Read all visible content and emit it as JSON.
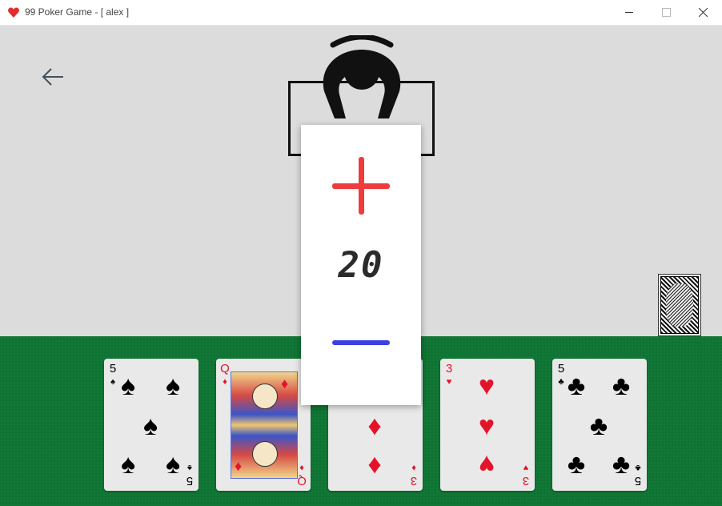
{
  "window": {
    "title": "99 Poker Game - [ alex ]",
    "icon": "heart-icon",
    "controls": [
      "minimize-icon",
      "maximize-icon",
      "close-icon"
    ]
  },
  "colors": {
    "table": "#dcdcdc",
    "felt": "#0e7433",
    "plus": "#ee3b3b",
    "minus": "#3b3fe6",
    "red_suit": "#e4132a"
  },
  "back_button": {
    "icon": "arrow-left-icon"
  },
  "opponent": {
    "icon": "player-seat-icon"
  },
  "deck": {
    "icon": "card-back-icon"
  },
  "value_popup": {
    "value": "20",
    "increase_icon": "plus-icon",
    "decrease_icon": "minus-icon"
  },
  "hand": [
    {
      "rank": "5",
      "suit": "♠",
      "color": "black"
    },
    {
      "rank": "Q",
      "suit": "♦",
      "color": "red"
    },
    {
      "rank": "3",
      "suit": "♦",
      "color": "red"
    },
    {
      "rank": "3",
      "suit": "♥",
      "color": "red"
    },
    {
      "rank": "5",
      "suit": "♣",
      "color": "black"
    }
  ]
}
